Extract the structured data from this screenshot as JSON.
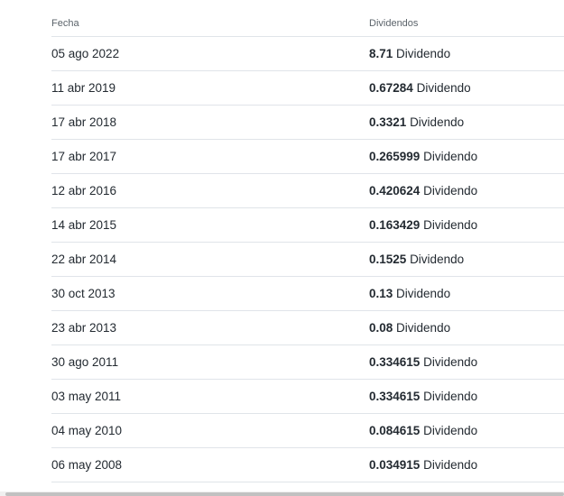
{
  "table": {
    "headers": {
      "date": "Fecha",
      "dividends": "Dividendos"
    },
    "rows": [
      {
        "date": "05 ago 2022",
        "amount": "8.71",
        "type": "Dividendo"
      },
      {
        "date": "11 abr 2019",
        "amount": "0.67284",
        "type": "Dividendo"
      },
      {
        "date": "17 abr 2018",
        "amount": "0.3321",
        "type": "Dividendo"
      },
      {
        "date": "17 abr 2017",
        "amount": "0.265999",
        "type": "Dividendo"
      },
      {
        "date": "12 abr 2016",
        "amount": "0.420624",
        "type": "Dividendo"
      },
      {
        "date": "14 abr 2015",
        "amount": "0.163429",
        "type": "Dividendo"
      },
      {
        "date": "22 abr 2014",
        "amount": "0.1525",
        "type": "Dividendo"
      },
      {
        "date": "30 oct 2013",
        "amount": "0.13",
        "type": "Dividendo"
      },
      {
        "date": "23 abr 2013",
        "amount": "0.08",
        "type": "Dividendo"
      },
      {
        "date": "30 ago 2011",
        "amount": "0.334615",
        "type": "Dividendo"
      },
      {
        "date": "03 may 2011",
        "amount": "0.334615",
        "type": "Dividendo"
      },
      {
        "date": "04 may 2010",
        "amount": "0.084615",
        "type": "Dividendo"
      },
      {
        "date": "06 may 2008",
        "amount": "0.034915",
        "type": "Dividendo"
      }
    ]
  }
}
